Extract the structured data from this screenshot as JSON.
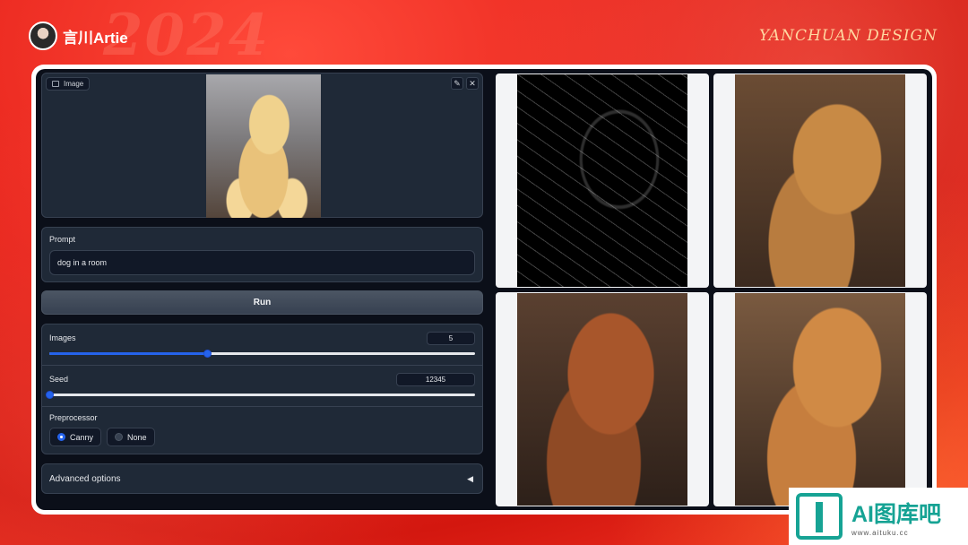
{
  "brand": {
    "name": "言川Artie",
    "studio": "YANCHUAN DESIGN",
    "deco": "2024"
  },
  "image_panel": {
    "label": "Image",
    "edit_icon": "pencil-icon",
    "close_icon": "close-icon"
  },
  "prompt": {
    "label": "Prompt",
    "value": "dog in a room"
  },
  "run": {
    "label": "Run"
  },
  "images": {
    "label": "Images",
    "value": "5",
    "fraction": 0.37
  },
  "seed": {
    "label": "Seed",
    "value": "12345",
    "fraction": 0.0
  },
  "preprocessor": {
    "label": "Preprocessor",
    "options": [
      {
        "label": "Canny",
        "selected": true
      },
      {
        "label": "None",
        "selected": false
      }
    ]
  },
  "advanced": {
    "label": "Advanced options",
    "caret": "◀"
  },
  "watermark": {
    "title": "AI图库吧",
    "url": "www.aituku.cc"
  },
  "colors": {
    "accent": "#2563eb",
    "panel": "#1f2937",
    "bg": "#0b0f19",
    "brand_red": "#e8241c",
    "watermark": "#16a394"
  }
}
